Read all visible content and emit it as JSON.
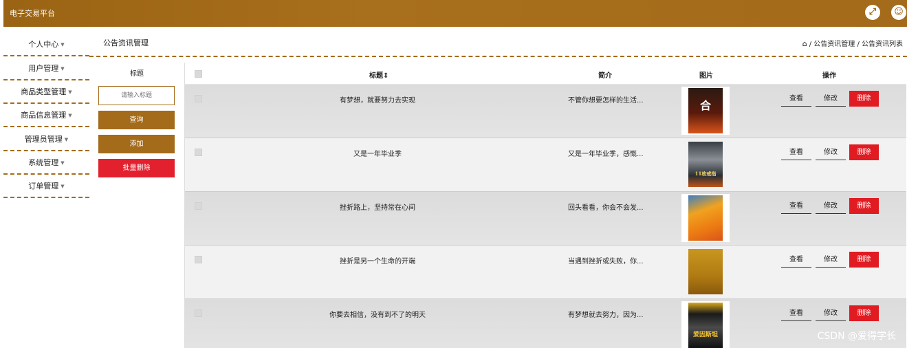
{
  "app": {
    "title": "电子交易平台"
  },
  "topbar_icons": {
    "fullscreen": "expand-icon",
    "user": "user-icon"
  },
  "sidebar": {
    "items": [
      {
        "label": "个人中心"
      },
      {
        "label": "用户管理"
      },
      {
        "label": "商品类型管理"
      },
      {
        "label": "商品信息管理"
      },
      {
        "label": "管理员管理"
      },
      {
        "label": "系统管理"
      },
      {
        "label": "订单管理"
      }
    ]
  },
  "page": {
    "title": "公告资讯管理"
  },
  "breadcrumb": {
    "text": "/ 公告资讯管理 / 公告资讯列表"
  },
  "search": {
    "label": "标题",
    "placeholder": "请输入标题",
    "query_label": "查询",
    "add_label": "添加",
    "bulk_delete_label": "批量删除"
  },
  "table": {
    "columns": {
      "title": "标题",
      "intro": "简介",
      "image": "图片",
      "actions": "操作"
    },
    "action_labels": {
      "view": "查看",
      "edit": "修改",
      "delete": "删除"
    },
    "rows": [
      {
        "title": "有梦想，就要努力去实现",
        "intro": "不管你想要怎样的生活...",
        "book_text": "合"
      },
      {
        "title": "又是一年毕业季",
        "intro": "又是一年毕业季，感慨...",
        "book_text": "11枚戒指"
      },
      {
        "title": "挫折路上，坚持常在心间",
        "intro": "回头看看，你会不会发...",
        "book_text": ""
      },
      {
        "title": "挫折是另一个生命的开端",
        "intro": "当遇到挫折或失败，你...",
        "book_text": ""
      },
      {
        "title": "你要去相信，没有到不了的明天",
        "intro": "有梦想就去努力，因为...",
        "book_text": "爱因斯坦"
      }
    ]
  },
  "watermark": "CSDN @爱得学长",
  "colors": {
    "brand": "#a36b1a",
    "danger": "#e3202e"
  }
}
